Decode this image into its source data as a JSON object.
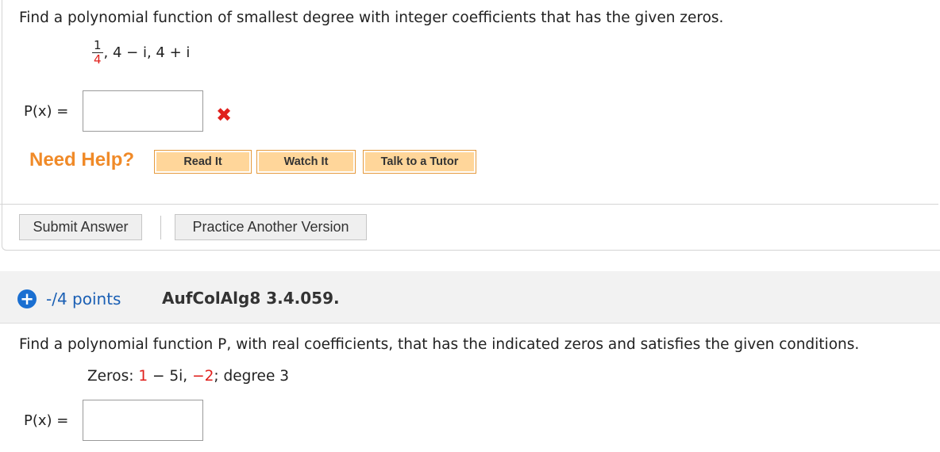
{
  "question1": {
    "prompt": "Find a polynomial function of smallest degree with integer coefficients that has the given zeros.",
    "zeros": {
      "fraction_numerator": "1",
      "fraction_denominator": "4",
      "rest": ", 4 − i, 4 + i"
    },
    "answer_label": "P(x) =",
    "answer_value": "",
    "status_mark": "✖",
    "need_help_label": "Need Help?",
    "help_buttons": [
      "Read It",
      "Watch It",
      "Talk to a Tutor"
    ],
    "submit_label": "Submit Answer",
    "practice_label": "Practice Another Version"
  },
  "question2": {
    "expand_icon": "+",
    "points": "-/4 points",
    "id": "AufColAlg8 3.4.059.",
    "prompt": "Find a polynomial function P, with real coefficients, that has the indicated zeros and satisfies the given conditions.",
    "zeros_label": "Zeros:",
    "zero_a_real": "1",
    "zero_a_rest": "− 5i,",
    "zero_b": "−2",
    "degree_text": "; degree 3",
    "answer_label": "P(x) =",
    "answer_value": ""
  },
  "colors": {
    "accent_orange": "#f08a28",
    "error_red": "#e0201c",
    "link_blue": "#1a5fb4"
  }
}
